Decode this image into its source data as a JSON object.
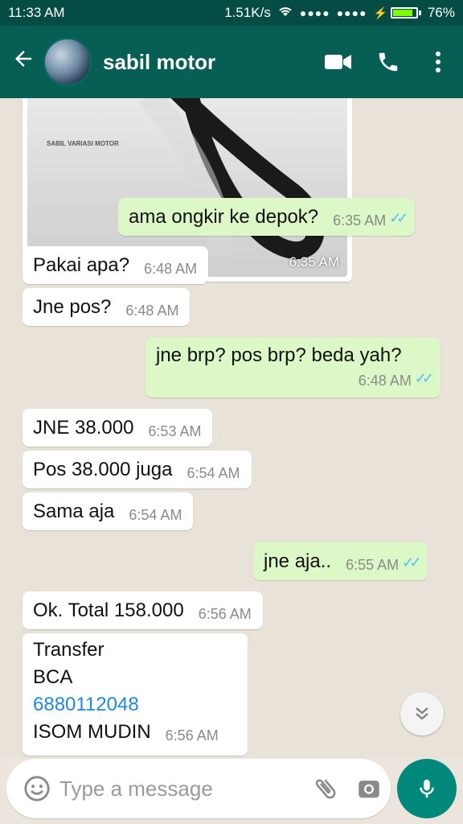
{
  "status": {
    "time": "11:33 AM",
    "speed": "1.51K/s",
    "signal1": "●●●●",
    "signal2": "●●●●",
    "battery": "76%"
  },
  "header": {
    "contact_name": "sabil motor"
  },
  "image_message": {
    "time": "6:35 AM",
    "brand_text": "SABIL VARIASI MOTOR"
  },
  "messages": [
    {
      "dir": "out",
      "text": "ama ongkir ke depok?",
      "time": "6:35 AM"
    },
    {
      "dir": "in",
      "text": "Pakai apa?",
      "time": "6:48 AM"
    },
    {
      "dir": "in",
      "text": "Jne pos?",
      "time": "6:48 AM"
    },
    {
      "dir": "out",
      "text": "jne brp? pos brp? beda yah?",
      "time": "6:48 AM"
    },
    {
      "dir": "in",
      "text": "JNE 38.000",
      "time": "6:53 AM"
    },
    {
      "dir": "in",
      "text": "Pos 38.000 juga",
      "time": "6:54 AM"
    },
    {
      "dir": "in",
      "text": "Sama aja",
      "time": "6:54 AM"
    },
    {
      "dir": "out",
      "text": "jne aja..",
      "time": "6:55 AM"
    },
    {
      "dir": "in",
      "text": "Ok. Total 158.000",
      "time": "6:56 AM"
    },
    {
      "dir": "in",
      "lines": [
        "Transfer",
        "BCA",
        "6880112048",
        "ISOM MUDIN"
      ],
      "time": "6:56 AM"
    }
  ],
  "input": {
    "placeholder": "Type a message"
  },
  "icons": {
    "back": "arrow-left-icon",
    "video": "video-call-icon",
    "phone": "phone-icon",
    "menu": "more-vert-icon",
    "emoji": "emoji-icon",
    "attach": "paperclip-icon",
    "camera": "camera-icon",
    "mic": "mic-icon",
    "scroll": "chevron-double-down-icon"
  },
  "colors": {
    "header": "#075E54",
    "statusbar": "#054D44",
    "outgoing_bubble": "#DCF8C6",
    "incoming_bubble": "#FFFFFF",
    "read_ticks": "#4FC3F7",
    "mic_button": "#00897B",
    "link": "#1E88E5"
  }
}
